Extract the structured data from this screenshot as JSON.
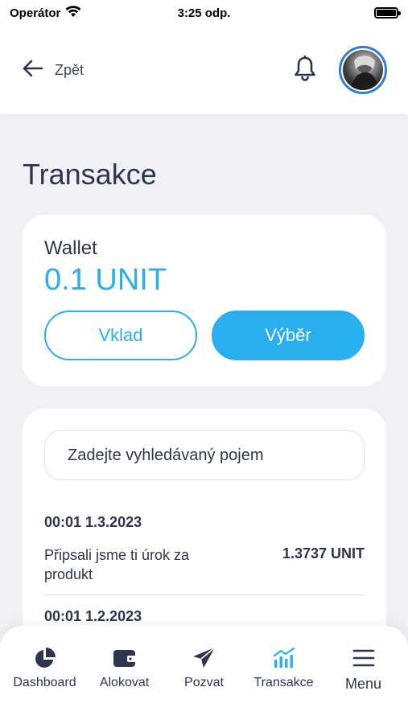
{
  "status_bar": {
    "carrier": "Operátor",
    "time": "3:25 odp."
  },
  "header": {
    "back_label": "Zpět",
    "icons": [
      "arrow-left-icon",
      "bell-icon",
      "avatar"
    ]
  },
  "page": {
    "title": "Transakce"
  },
  "wallet": {
    "label": "Wallet",
    "amount": "0.1 UNIT",
    "deposit_label": "Vklad",
    "withdraw_label": "Výběr"
  },
  "transactions": {
    "search_placeholder": "Zadejte vyhledávaný pojem",
    "items": [
      {
        "datetime": "00:01 1.3.2023",
        "description": "Připsali jsme ti úrok za produkt",
        "amount": "1.3737 UNIT"
      },
      {
        "datetime": "00:01 1.2.2023"
      }
    ]
  },
  "bottom_nav": {
    "items": [
      {
        "label": "Dashboard",
        "icon": "pie-chart-icon"
      },
      {
        "label": "Alokovat",
        "icon": "wallet-icon"
      },
      {
        "label": "Pozvat",
        "icon": "paper-plane-icon"
      },
      {
        "label": "Transakce",
        "icon": "bar-chart-icon",
        "active": true
      },
      {
        "label": "Menu",
        "icon": "hamburger-icon"
      }
    ]
  },
  "colors": {
    "accent": "#29aef0",
    "text": "#2d3550",
    "background": "#f1f1f3",
    "active_nav_icon": "#29aef0",
    "nav_icon": "#2d3550"
  }
}
